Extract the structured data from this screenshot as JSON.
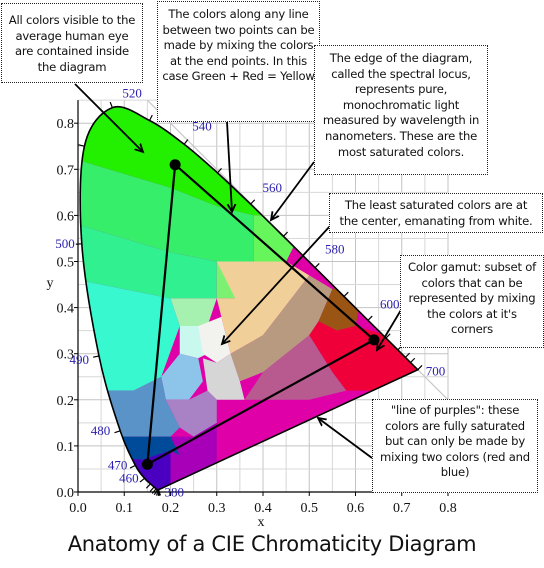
{
  "title": "Anatomy of a CIE Chromaticity Diagram",
  "annotations": [
    {
      "id": "visible",
      "text": "All colors visible to the average human eye are contained inside the diagram"
    },
    {
      "id": "mixing",
      "text": "The colors along any line between two points can be made by mixing the colors at the end points. In this case Green + Red = Yellow"
    },
    {
      "id": "locus",
      "text": "The edge of the diagram, called the spectral locus, represents pure, monochromatic light measured by wavelength in nanometers. These are the most saturated colors."
    },
    {
      "id": "center",
      "text": "The least saturated colors are at the center, emanating from white."
    },
    {
      "id": "gamut",
      "text": "Color gamut: subset of colors that can be represented by mixing the colors at it's corners"
    },
    {
      "id": "purples",
      "text": "\"line of purples\": these colors are fully saturated but can only be made by mixing two colors (red and blue)"
    }
  ],
  "chart_data": {
    "type": "scatter",
    "title": "Anatomy of a CIE Chromaticity Diagram",
    "xlabel": "x",
    "ylabel": "y",
    "xlim": [
      0.0,
      0.8
    ],
    "ylim": [
      0.0,
      0.85
    ],
    "grid": true,
    "x_ticks": [
      "0.0",
      "0.1",
      "0.2",
      "0.3",
      "0.4",
      "0.5",
      "0.6",
      "0.7",
      "0.8"
    ],
    "y_ticks": [
      "0.0",
      "0.1",
      "0.2",
      "0.3",
      "0.4",
      "0.5",
      "0.6",
      "0.7",
      "0.8"
    ],
    "spectral_locus": [
      [
        0.1741,
        0.005
      ],
      [
        0.1738,
        0.0049
      ],
      [
        0.1736,
        0.0049
      ],
      [
        0.173,
        0.0048
      ],
      [
        0.1726,
        0.0048
      ],
      [
        0.1714,
        0.0051
      ],
      [
        0.1689,
        0.0069
      ],
      [
        0.1644,
        0.0109
      ],
      [
        0.1566,
        0.0177
      ],
      [
        0.144,
        0.0297
      ],
      [
        0.1241,
        0.0578
      ],
      [
        0.0913,
        0.1327
      ],
      [
        0.0454,
        0.295
      ],
      [
        0.0082,
        0.5384
      ],
      [
        0.0139,
        0.7502
      ],
      [
        0.0743,
        0.8338
      ],
      [
        0.1547,
        0.8059
      ],
      [
        0.2296,
        0.7543
      ],
      [
        0.3016,
        0.6923
      ],
      [
        0.3731,
        0.6245
      ],
      [
        0.4441,
        0.5547
      ],
      [
        0.5125,
        0.4866
      ],
      [
        0.5752,
        0.4242
      ],
      [
        0.627,
        0.3725
      ],
      [
        0.6658,
        0.334
      ],
      [
        0.6915,
        0.3083
      ],
      [
        0.7079,
        0.292
      ],
      [
        0.719,
        0.2809
      ],
      [
        0.7347,
        0.2653
      ]
    ],
    "wavelength_labels": [
      {
        "nm": "380",
        "x": 0.1741,
        "y": 0.005
      },
      {
        "nm": "460",
        "x": 0.144,
        "y": 0.0297
      },
      {
        "nm": "470",
        "x": 0.1241,
        "y": 0.0578
      },
      {
        "nm": "480",
        "x": 0.0913,
        "y": 0.1327
      },
      {
        "nm": "490",
        "x": 0.0454,
        "y": 0.295
      },
      {
        "nm": "500",
        "x": 0.0082,
        "y": 0.5384
      },
      {
        "nm": "520",
        "x": 0.0743,
        "y": 0.8338
      },
      {
        "nm": "540",
        "x": 0.2296,
        "y": 0.7543
      },
      {
        "nm": "560",
        "x": 0.3731,
        "y": 0.6245
      },
      {
        "nm": "580",
        "x": 0.5125,
        "y": 0.4866
      },
      {
        "nm": "600",
        "x": 0.627,
        "y": 0.3725
      },
      {
        "nm": "700",
        "x": 0.7347,
        "y": 0.2653
      }
    ],
    "gamut_triangle": [
      {
        "name": "green",
        "x": 0.21,
        "y": 0.71
      },
      {
        "name": "red",
        "x": 0.64,
        "y": 0.33
      },
      {
        "name": "blue",
        "x": 0.15,
        "y": 0.06
      }
    ],
    "colors": {
      "label": "#2a1fb0",
      "green": "#22f000",
      "yellow_green": "#66f55a",
      "cyan_green": "#3ef09a",
      "aqua": "#38f8d0",
      "steel_blue": "#5a93c8",
      "navy": "#004a9a",
      "violet": "#4a00c0",
      "magenta": "#e000a8",
      "purple": "#a800b8",
      "red": "#f00038",
      "brown": "#9a5414",
      "tan": "#f0d098",
      "taupe": "#b89a80",
      "white": "#f2f2ee"
    }
  }
}
